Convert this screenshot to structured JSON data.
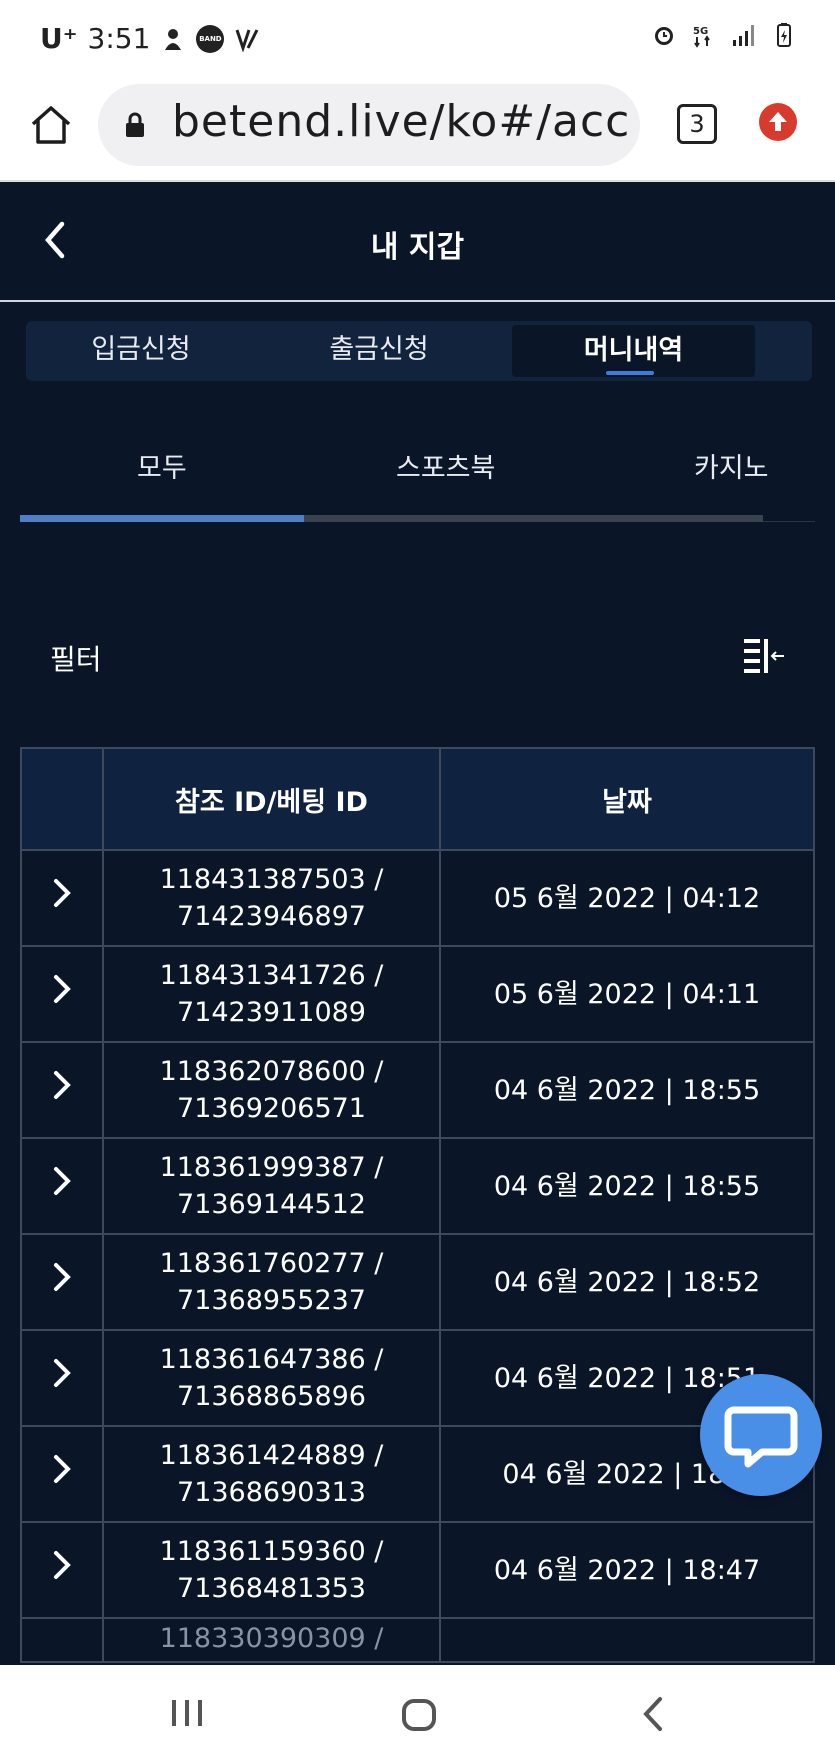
{
  "status_bar": {
    "carrier": "U⁺",
    "time": "3:51",
    "badge_label": "BAND"
  },
  "browser": {
    "url": "betend.live/ko#/acc",
    "tab_count": "3"
  },
  "header": {
    "title": "내 지갑"
  },
  "main_tabs": [
    {
      "label": "입금신청",
      "active": false
    },
    {
      "label": "출금신청",
      "active": false
    },
    {
      "label": "머니내역",
      "active": true
    }
  ],
  "sub_tabs": [
    {
      "label": "모두",
      "active": true
    },
    {
      "label": "스포츠북",
      "active": false
    },
    {
      "label": "카지노",
      "active": false
    }
  ],
  "filter": {
    "label": "필터"
  },
  "table": {
    "headers": [
      "",
      "참조 ID/베팅 ID",
      "날짜"
    ],
    "rows": [
      {
        "ref_id": "118431387503 /",
        "bet_id": "71423946897",
        "date": "05 6월 2022 | 04:12"
      },
      {
        "ref_id": "118431341726 /",
        "bet_id": "71423911089",
        "date": "05 6월 2022 | 04:11"
      },
      {
        "ref_id": "118362078600 /",
        "bet_id": "71369206571",
        "date": "04 6월 2022 | 18:55"
      },
      {
        "ref_id": "118361999387 /",
        "bet_id": "71369144512",
        "date": "04 6월 2022 | 18:55"
      },
      {
        "ref_id": "118361760277 /",
        "bet_id": "71368955237",
        "date": "04 6월 2022 | 18:52"
      },
      {
        "ref_id": "118361647386 /",
        "bet_id": "71368865896",
        "date": "04 6월 2022 | 18:51"
      },
      {
        "ref_id": "118361424889 /",
        "bet_id": "71368690313",
        "date": "04 6월 2022 | 18:4"
      },
      {
        "ref_id": "118361159360 /",
        "bet_id": "71368481353",
        "date": "04 6월 2022 | 18:47"
      }
    ],
    "partial_row": "118330390309 /"
  },
  "colors": {
    "background": "#0a1527",
    "accent": "#3b7dd8",
    "chat_button": "#4a8fe7",
    "browser_update": "#d93a2e"
  }
}
